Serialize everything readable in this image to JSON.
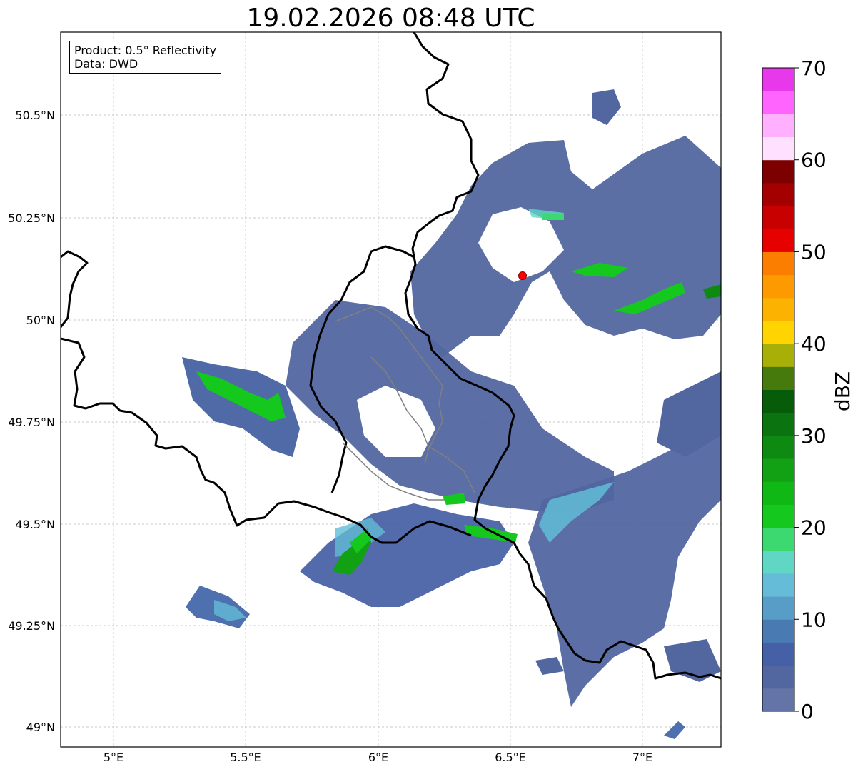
{
  "title": "19.02.2026 08:48 UTC",
  "info": {
    "product_line": "Product: 0.5° Reflectivity",
    "data_line": "Data: DWD"
  },
  "lon_ticks": [
    "5°E",
    "5.5°E",
    "6°E",
    "6.5°E",
    "7°E"
  ],
  "lat_ticks": [
    "50.5°N",
    "50.25°N",
    "50°N",
    "49.75°N",
    "49.5°N",
    "49.25°N",
    "49°N"
  ],
  "extent": {
    "lon": [
      4.8,
      7.3
    ],
    "lat": [
      48.95,
      50.7
    ]
  },
  "radar_site": {
    "lon": 6.55,
    "lat": 50.11,
    "color": "#ff0000"
  },
  "colorbar": {
    "label": "dBZ",
    "tick_labels": [
      "0",
      "10",
      "20",
      "30",
      "40",
      "50",
      "60",
      "70"
    ],
    "min": 0,
    "max": 70,
    "colors": [
      "#6474a6",
      "#5266a0",
      "#4660a8",
      "#4a7ab2",
      "#589cc8",
      "#64bcd8",
      "#60d6c4",
      "#3cd870",
      "#14c81e",
      "#10b816",
      "#12a014",
      "#0e8a12",
      "#0b7410",
      "#075c0a",
      "#467a0c",
      "#a8b008",
      "#ffd400",
      "#fcb200",
      "#fc9a00",
      "#fc7e00",
      "#e60000",
      "#c80000",
      "#a40000",
      "#7c0000",
      "#ffe0ff",
      "#ffb0ff",
      "#ff64ff",
      "#e838ec"
    ]
  }
}
